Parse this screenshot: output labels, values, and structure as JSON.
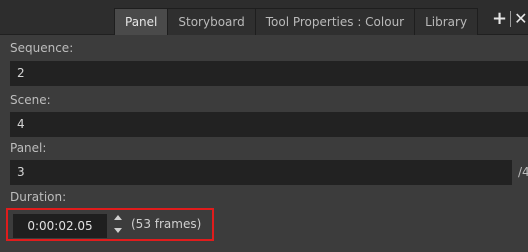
{
  "tabs": [
    {
      "label": "Panel",
      "active": true
    },
    {
      "label": "Storyboard",
      "active": false
    },
    {
      "label": "Tool Properties : Colour",
      "active": false
    },
    {
      "label": "Library",
      "active": false
    }
  ],
  "tab_actions": {
    "add_icon": "plus-icon",
    "close_icon": "close-icon"
  },
  "fields": {
    "sequence": {
      "label": "Sequence:",
      "value": "2"
    },
    "scene": {
      "label": "Scene:",
      "value": "4"
    },
    "panel": {
      "label": "Panel:",
      "value": "3",
      "suffix": "/4"
    },
    "duration": {
      "label": "Duration:",
      "value": "0:00:02.05",
      "frames_text": "(53 frames)"
    }
  },
  "colors": {
    "highlight": "#e01c1c",
    "background": "#3c3c3c",
    "field": "#222222"
  }
}
